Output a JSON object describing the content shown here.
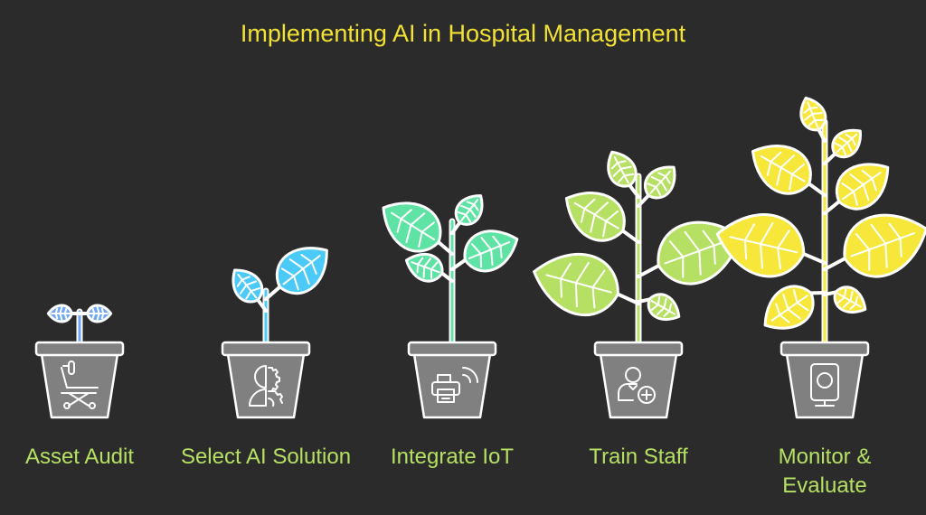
{
  "title": "Implementing AI in Hospital Management",
  "steps": [
    {
      "label": "Asset Audit",
      "icon": "wheelchair-icon",
      "leaf_color": "#6fa6f6"
    },
    {
      "label": "Select AI Solution",
      "icon": "head-gear-icon",
      "leaf_color": "#4ccaf7"
    },
    {
      "label": "Integrate IoT",
      "icon": "wireless-printer-icon",
      "leaf_color": "#5fe3a4"
    },
    {
      "label": "Train Staff",
      "icon": "user-add-icon",
      "leaf_color": "#b6e063"
    },
    {
      "label": "Monitor &\nEvaluate",
      "icon": "monitor-device-icon",
      "leaf_color": "#f7e73a"
    }
  ],
  "colors": {
    "background": "#2b2b2b",
    "title": "#f2e234",
    "label": "#b6e063",
    "pot": "#808080",
    "outline": "#ffffff"
  }
}
